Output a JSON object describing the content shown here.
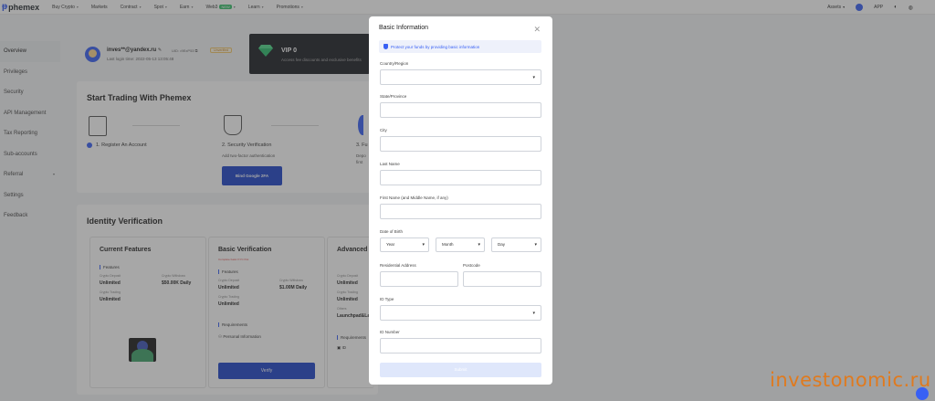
{
  "nav": {
    "logo": "phemex",
    "items": [
      "Buy Crypto",
      "Markets",
      "Contract",
      "Spot",
      "Earn",
      "Web3",
      "Learn",
      "Promotions"
    ],
    "web3_badge": "NEW",
    "assets": "Assets",
    "app": "APP"
  },
  "sidebar": {
    "items": [
      "Overview",
      "Privileges",
      "Security",
      "API Management",
      "Tax Reporting",
      "Sub-accounts",
      "Referral",
      "Settings",
      "Feedback"
    ]
  },
  "user": {
    "email": "inves**@yandex.ru",
    "uid": "UID: •9ExP53",
    "status": "Unverified",
    "last_login": "Last login time: 2022-05-13 13:05:48"
  },
  "vip": {
    "title": "VIP 0",
    "subtitle": "Access fee discounts and exclusive benefits"
  },
  "start_trading": {
    "title": "Start Trading With Phemex",
    "step1": "1. Register An Account",
    "step2": "2. Security Verification",
    "step2_desc": "Add two-factor authentication",
    "step3": "3. Fu",
    "step3_desc1": "Depo",
    "step3_desc2": "first",
    "google_btn": "Bind Google 2FA"
  },
  "identity": {
    "title": "Identity Verification",
    "current": {
      "heading": "Current Features",
      "features": "Features",
      "crypto_deposit": "Crypto Deposit",
      "crypto_deposit_val": "Unlimited",
      "crypto_withdraw": "Crypto Withdraw",
      "crypto_withdraw_val": "$50.00K Daily",
      "crypto_trading": "Crypto Trading",
      "crypto_trading_val": "Unlimited"
    },
    "basic": {
      "heading": "Basic Verification",
      "sub": "Complete basic KYC first",
      "features": "Features",
      "crypto_deposit": "Crypto Deposit",
      "crypto_deposit_val": "Unlimited",
      "crypto_withdraw": "Crypto Withdraw",
      "crypto_withdraw_val": "$1.00M Daily",
      "crypto_trading": "Crypto Trading",
      "crypto_trading_val": "Unlimited",
      "requirements": "Requirements",
      "personal_info": "Personal Information",
      "verify_btn": "Verify"
    },
    "advanced": {
      "heading": "Advanced",
      "crypto_deposit": "Crypto Deposit",
      "crypto_deposit_val": "Unlimited",
      "crypto_trading": "Crypto Trading",
      "crypto_trading_val": "Unlimited",
      "others": "Others",
      "others_val": "Launchpad&La",
      "requirements": "Requirements",
      "id": "ID"
    }
  },
  "modal": {
    "title": "Basic Information",
    "info": "Protect your funds by providing basic information",
    "country_label": "Country/Region",
    "state_label": "State/Province",
    "city_label": "City",
    "lastname_label": "Last Name",
    "firstname_label": "First Name (and Middle Name, if any)",
    "dob_label": "Date of Birth",
    "year": "Year",
    "month": "Month",
    "day": "Day",
    "address_label": "Residential Address",
    "postcode_label": "Postcode",
    "idtype_label": "ID Type",
    "idnumber_label": "ID Number",
    "submit": "Submit"
  },
  "watermark": "investonomic.ru"
}
